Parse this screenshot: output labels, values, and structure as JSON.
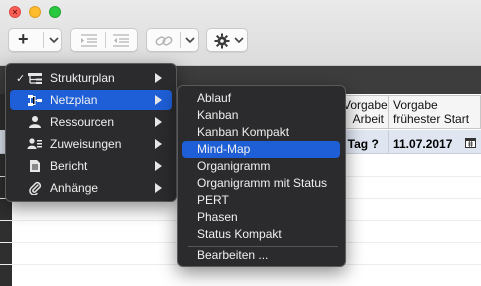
{
  "toolbar": {
    "add_label": "+",
    "chevron": "⌄"
  },
  "table": {
    "headers": [
      {
        "line1": "Vorgabe",
        "line2": "Arbeit"
      },
      {
        "line1": "Vorgabe",
        "line2": "frühester Start"
      }
    ],
    "row": {
      "work": "l Tag ?",
      "start": "11.07.2017"
    }
  },
  "main_menu": {
    "items": [
      {
        "label": "Strukturplan",
        "checked": true,
        "icon": "structure-icon"
      },
      {
        "label": "Netzplan",
        "checked": false,
        "icon": "network-icon",
        "selected": true
      },
      {
        "label": "Ressourcen",
        "checked": false,
        "icon": "person-icon"
      },
      {
        "label": "Zuweisungen",
        "checked": false,
        "icon": "assignment-icon"
      },
      {
        "label": "Bericht",
        "checked": false,
        "icon": "report-icon"
      },
      {
        "label": "Anhänge",
        "checked": false,
        "icon": "paperclip-icon"
      }
    ],
    "check_mark": "✓"
  },
  "sub_menu": {
    "items": [
      "Ablauf",
      "Kanban",
      "Kanban Kompakt",
      "Mind-Map",
      "Organigramm",
      "Organigramm mit Status",
      "PERT",
      "Phasen",
      "Status Kompakt"
    ],
    "selected": "Mind-Map",
    "edit_label": "Bearbeiten ..."
  },
  "colors": {
    "menu_bg": "#2b2b2d",
    "highlight": "#1e5ed6",
    "row_bg": "#dfe6f1"
  }
}
